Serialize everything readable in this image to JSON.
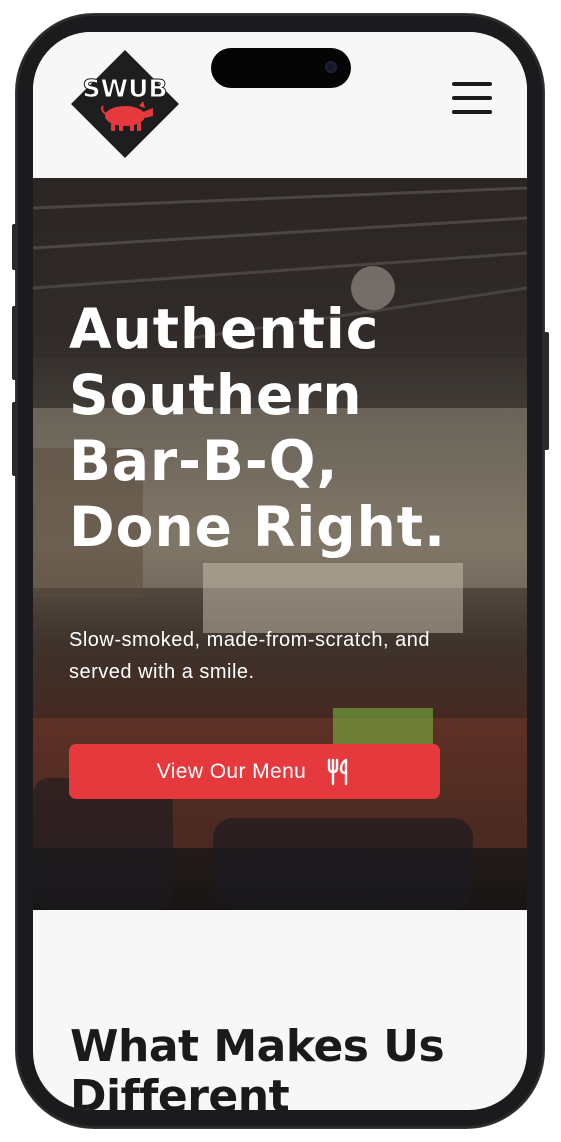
{
  "brand": {
    "logo_text": "SWUB",
    "logo_bg": "#1e1e1e",
    "logo_accent": "#e6393d",
    "logo_icon": "pig-icon"
  },
  "header": {
    "menu_icon": "hamburger-menu-icon"
  },
  "hero": {
    "title_lines": [
      "Authentic",
      "Southern",
      "Bar-B-Q,",
      "Done Right."
    ],
    "subtitle": "Slow-smoked, made-from-scratch, and served with a smile.",
    "cta_label": "View Our Menu",
    "cta_icon": "utensils-icon",
    "cta_color": "#e6393d"
  },
  "section": {
    "title": "What Makes Us Different"
  }
}
